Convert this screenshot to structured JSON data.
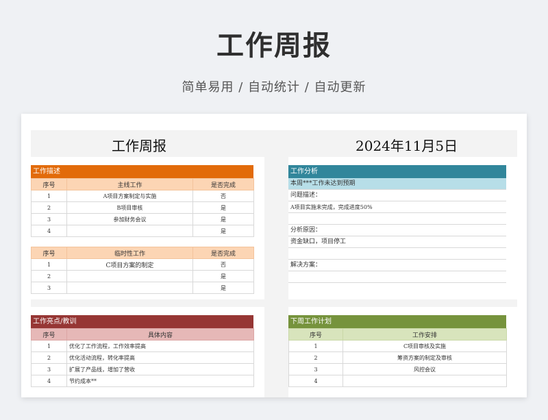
{
  "page": {
    "title": "工作周报",
    "subtitle": "简单易用 / 自动统计 / 自动更新"
  },
  "sheet": {
    "title": "工作周报",
    "date": "2024年11月5日",
    "work_desc": {
      "title": "工作描述",
      "main": {
        "headers": [
          "序号",
          "主线工作",
          "是否完成"
        ],
        "rows": [
          [
            "1",
            "A项目方案制定与实施",
            "否"
          ],
          [
            "2",
            "B项目审核",
            "是"
          ],
          [
            "3",
            "参加财务会议",
            "是"
          ],
          [
            "4",
            "",
            "是"
          ]
        ]
      },
      "temp": {
        "headers": [
          "序号",
          "临时性工作",
          "是否完成"
        ],
        "rows": [
          [
            "1",
            "C项目方案的制定",
            "否"
          ],
          [
            "2",
            "",
            "是"
          ],
          [
            "3",
            "",
            "是"
          ]
        ]
      }
    },
    "analysis": {
      "title": "工作分析",
      "summary": "本周***工作未达到预期",
      "lines": [
        "问题描述：",
        "A项目实施未完成，完成进度50%",
        "",
        "分析原因：",
        "资金缺口，项目停工",
        "",
        "解决方案：",
        ""
      ]
    },
    "highlights": {
      "title": "工作亮点/教训",
      "headers": [
        "序号",
        "具体内容"
      ],
      "rows": [
        [
          "1",
          "优化了工作流程，工作效率提高"
        ],
        [
          "2",
          "优化活动流程，转化率提高"
        ],
        [
          "3",
          "扩展了产品线，增加了营收"
        ],
        [
          "4",
          "节约成本**"
        ]
      ]
    },
    "next_plan": {
      "title": "下周工作计划",
      "headers": [
        "序号",
        "工作安排"
      ],
      "rows": [
        [
          "1",
          "C项目审核及实施"
        ],
        [
          "2",
          "筹资方案的制定及审核"
        ],
        [
          "3",
          "风控会议"
        ],
        [
          "4",
          ""
        ]
      ]
    }
  }
}
